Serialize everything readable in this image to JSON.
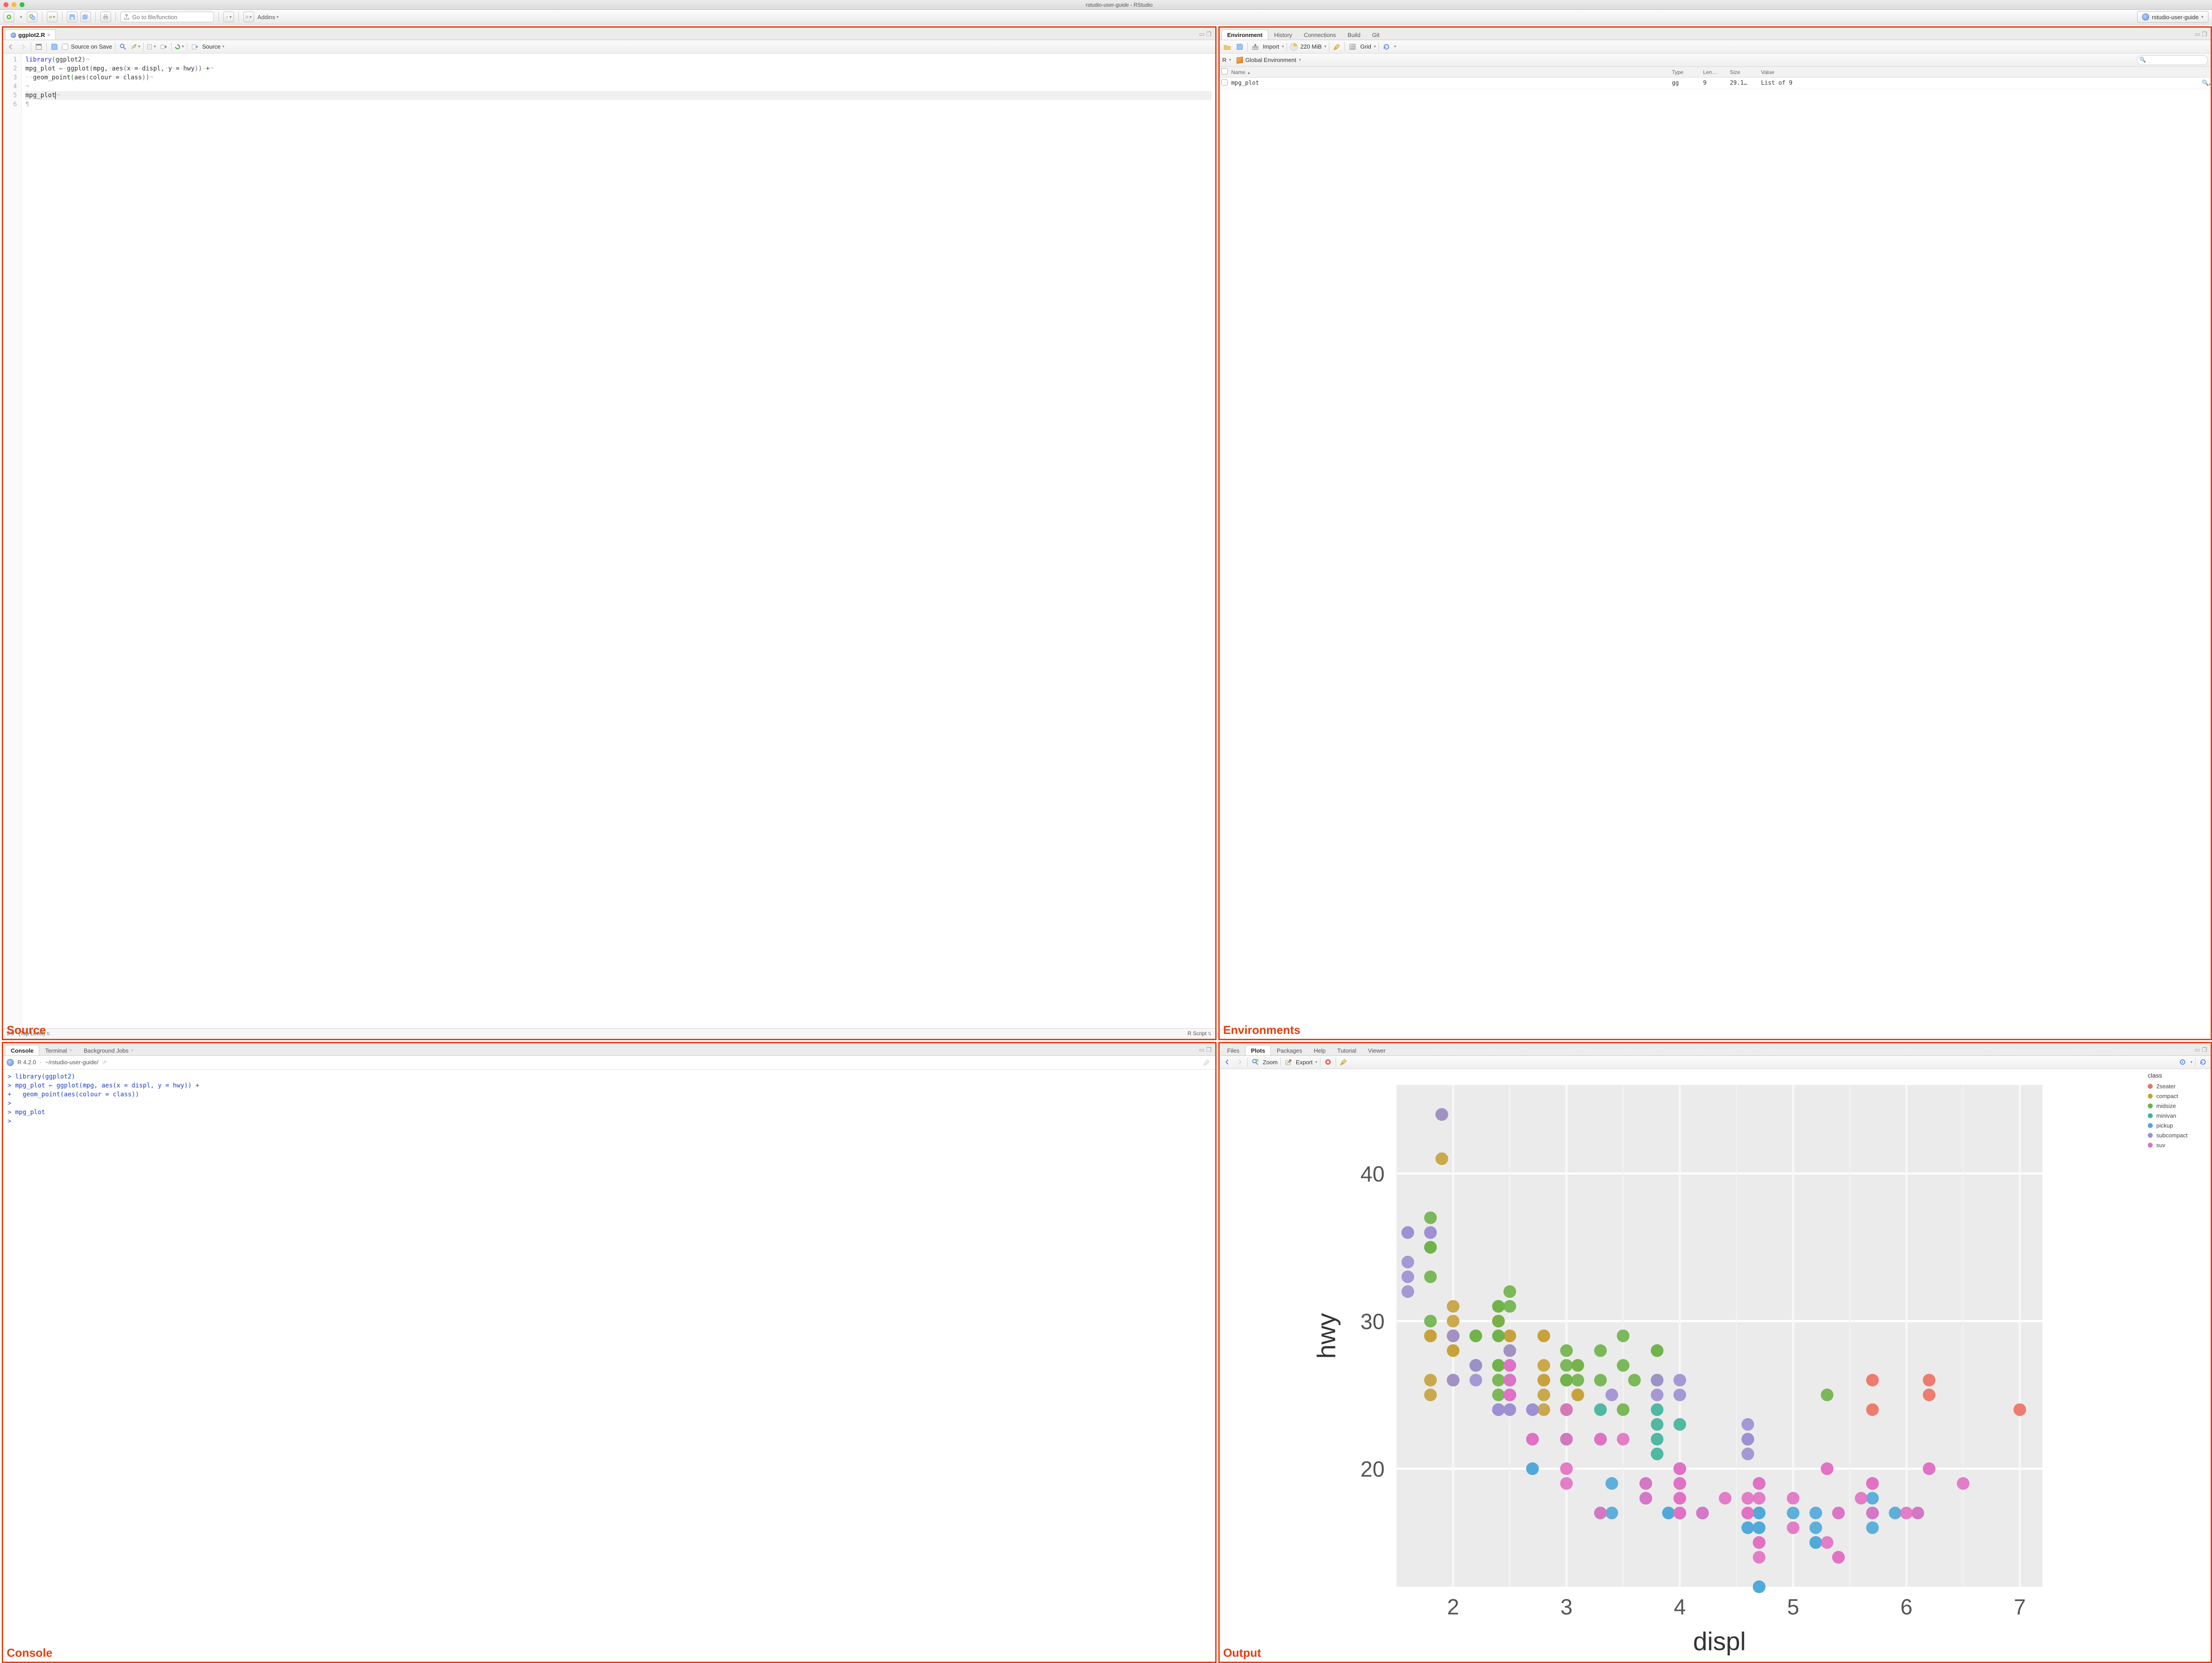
{
  "window": {
    "title": "rstudio-user-guide - RStudio"
  },
  "toolbar": {
    "goto_placeholder": "Go to file/function",
    "addins_label": "Addins",
    "project_label": "rstudio-user-guide"
  },
  "source": {
    "tab": "ggplot2.R",
    "source_on_save": "Source on Save",
    "source_btn": "Source",
    "cursor": "5:9",
    "scope": "(Top Level)",
    "lang": "R Script",
    "lines": [
      "1",
      "2",
      "3",
      "4",
      "5",
      "6"
    ]
  },
  "console": {
    "tabs": {
      "console": "Console",
      "terminal": "Terminal",
      "jobs": "Background Jobs"
    },
    "version": "R 4.2.0",
    "path": "~/rstudio-user-guide/",
    "lines": [
      "> library(ggplot2)",
      "> mpg_plot ← ggplot(mpg, aes(x = displ, y = hwy)) +",
      "+   geom_point(aes(colour = class))",
      ">",
      "> mpg_plot",
      "> "
    ]
  },
  "env": {
    "tabs": {
      "environment": "Environment",
      "history": "History",
      "connections": "Connections",
      "build": "Build",
      "git": "Git"
    },
    "import": "Import",
    "mem": "220 MiB",
    "grid": "Grid",
    "scope_lang": "R",
    "scope_env": "Global Environment",
    "search_placeholder": "",
    "cols": {
      "name": "Name",
      "type": "Type",
      "length": "Len…",
      "size": "Size",
      "value": "Value"
    },
    "row": {
      "name": "mpg_plot",
      "type": "gg",
      "length": "9",
      "size": "29.1…",
      "value": "List of 9"
    }
  },
  "output": {
    "tabs": {
      "files": "Files",
      "plots": "Plots",
      "packages": "Packages",
      "help": "Help",
      "tutorial": "Tutorial",
      "viewer": "Viewer"
    },
    "zoom": "Zoom",
    "export": "Export"
  },
  "labels": {
    "source": "Source",
    "console": "Console",
    "environments": "Environments",
    "output": "Output"
  },
  "chart_data": {
    "type": "scatter",
    "title": "",
    "xlabel": "displ",
    "ylabel": "hwy",
    "xlim": [
      1.5,
      7.2
    ],
    "ylim": [
      12,
      46
    ],
    "x_ticks": [
      2,
      3,
      4,
      5,
      6,
      7
    ],
    "y_ticks": [
      20,
      30,
      40
    ],
    "legend_title": "class",
    "series": [
      {
        "name": "2seater",
        "color": "#ed7062",
        "points": [
          [
            5.7,
            26
          ],
          [
            5.7,
            24
          ],
          [
            6.2,
            26
          ],
          [
            6.2,
            25
          ],
          [
            7.0,
            24
          ]
        ]
      },
      {
        "name": "compact",
        "color": "#c7a13b",
        "points": [
          [
            1.8,
            29
          ],
          [
            1.8,
            29
          ],
          [
            2.0,
            31
          ],
          [
            2.0,
            30
          ],
          [
            2.8,
            26
          ],
          [
            2.8,
            26
          ],
          [
            3.1,
            27
          ],
          [
            1.8,
            26
          ],
          [
            1.8,
            25
          ],
          [
            2.0,
            28
          ],
          [
            2.0,
            29
          ],
          [
            2.8,
            27
          ],
          [
            2.8,
            25
          ],
          [
            3.1,
            25
          ],
          [
            3.1,
            25
          ],
          [
            2.4,
            30
          ],
          [
            2.4,
            30
          ],
          [
            2.5,
            26
          ],
          [
            2.5,
            27
          ],
          [
            2.2,
            27
          ],
          [
            2.2,
            29
          ],
          [
            2.4,
            31
          ],
          [
            2.4,
            30
          ],
          [
            3.0,
            26
          ],
          [
            2.0,
            29
          ],
          [
            2.0,
            29
          ],
          [
            2.0,
            28
          ],
          [
            2.0,
            29
          ],
          [
            2.8,
            24
          ],
          [
            1.9,
            44
          ],
          [
            2.0,
            26
          ],
          [
            2.0,
            29
          ],
          [
            2.0,
            29
          ],
          [
            2.0,
            29
          ],
          [
            2.0,
            29
          ],
          [
            2.5,
            29
          ],
          [
            2.5,
            29
          ],
          [
            2.8,
            29
          ],
          [
            2.8,
            29
          ],
          [
            1.9,
            41
          ],
          [
            1.9,
            44
          ],
          [
            2.0,
            29
          ],
          [
            2.0,
            26
          ],
          [
            2.5,
            28
          ],
          [
            2.5,
            29
          ],
          [
            1.8,
            29
          ],
          [
            1.8,
            29
          ]
        ]
      },
      {
        "name": "midsize",
        "color": "#6fb24a",
        "points": [
          [
            2.4,
            27
          ],
          [
            2.4,
            27
          ],
          [
            3.1,
            26
          ],
          [
            3.5,
            29
          ],
          [
            3.6,
            26
          ],
          [
            2.4,
            26
          ],
          [
            2.4,
            25
          ],
          [
            2.4,
            27
          ],
          [
            2.4,
            30
          ],
          [
            2.5,
            26
          ],
          [
            2.5,
            25
          ],
          [
            3.3,
            26
          ],
          [
            2.5,
            31
          ],
          [
            2.5,
            32
          ],
          [
            3.0,
            27
          ],
          [
            3.0,
            28
          ],
          [
            3.5,
            27
          ],
          [
            3.1,
            27
          ],
          [
            3.8,
            26
          ],
          [
            3.8,
            28
          ],
          [
            3.8,
            28
          ],
          [
            5.3,
            25
          ],
          [
            2.2,
            29
          ],
          [
            2.2,
            29
          ],
          [
            2.4,
            29
          ],
          [
            2.4,
            29
          ],
          [
            3.0,
            24
          ],
          [
            3.0,
            24
          ],
          [
            3.5,
            24
          ],
          [
            2.2,
            27
          ],
          [
            2.2,
            27
          ],
          [
            2.4,
            31
          ],
          [
            2.4,
            31
          ],
          [
            3.0,
            26
          ],
          [
            3.0,
            26
          ],
          [
            3.3,
            28
          ],
          [
            1.8,
            30
          ],
          [
            1.8,
            33
          ],
          [
            1.8,
            35
          ],
          [
            1.8,
            37
          ],
          [
            1.8,
            35
          ]
        ]
      },
      {
        "name": "minivan",
        "color": "#3fb39b",
        "points": [
          [
            2.4,
            24
          ],
          [
            3.0,
            22
          ],
          [
            3.3,
            22
          ],
          [
            3.3,
            22
          ],
          [
            3.3,
            17
          ],
          [
            3.8,
            24
          ],
          [
            3.8,
            22
          ],
          [
            3.8,
            21
          ],
          [
            3.8,
            23
          ],
          [
            3.3,
            24
          ],
          [
            4.0,
            23
          ]
        ]
      },
      {
        "name": "pickup",
        "color": "#4fa8d8",
        "points": [
          [
            3.7,
            19
          ],
          [
            3.7,
            18
          ],
          [
            3.9,
            17
          ],
          [
            3.9,
            17
          ],
          [
            4.7,
            19
          ],
          [
            4.7,
            19
          ],
          [
            4.7,
            12
          ],
          [
            5.2,
            17
          ],
          [
            5.2,
            15
          ],
          [
            5.7,
            16
          ],
          [
            5.9,
            17
          ],
          [
            4.7,
            17
          ],
          [
            4.7,
            16
          ],
          [
            4.7,
            16
          ],
          [
            4.7,
            17
          ],
          [
            4.7,
            12
          ],
          [
            4.7,
            17
          ],
          [
            5.2,
            16
          ],
          [
            5.2,
            15
          ],
          [
            5.7,
            18
          ],
          [
            5.7,
            17
          ],
          [
            6.1,
            17
          ],
          [
            2.7,
            20
          ],
          [
            2.7,
            20
          ],
          [
            2.7,
            22
          ],
          [
            3.4,
            17
          ],
          [
            3.4,
            19
          ],
          [
            4.0,
            20
          ],
          [
            4.0,
            17
          ],
          [
            4.6,
            16
          ],
          [
            5.0,
            17
          ],
          [
            4.2,
            17
          ],
          [
            4.2,
            17
          ],
          [
            4.6,
            16
          ]
        ]
      },
      {
        "name": "subcompact",
        "color": "#9d8fd2",
        "points": [
          [
            3.8,
            26
          ],
          [
            3.8,
            25
          ],
          [
            4.0,
            26
          ],
          [
            4.0,
            25
          ],
          [
            4.6,
            21
          ],
          [
            4.6,
            22
          ],
          [
            4.6,
            23
          ],
          [
            4.6,
            22
          ],
          [
            5.4,
            17
          ],
          [
            1.6,
            33
          ],
          [
            1.6,
            32
          ],
          [
            1.6,
            34
          ],
          [
            1.6,
            36
          ],
          [
            1.6,
            36
          ],
          [
            1.8,
            36
          ],
          [
            1.8,
            36
          ],
          [
            2.0,
            29
          ],
          [
            2.4,
            24
          ],
          [
            2.4,
            24
          ],
          [
            2.5,
            24
          ],
          [
            2.5,
            24
          ],
          [
            2.5,
            26
          ],
          [
            2.5,
            26
          ],
          [
            2.2,
            26
          ],
          [
            2.2,
            27
          ],
          [
            2.5,
            25
          ],
          [
            2.5,
            27
          ],
          [
            2.5,
            25
          ],
          [
            2.5,
            27
          ],
          [
            2.7,
            24
          ],
          [
            2.7,
            24
          ],
          [
            3.4,
            25
          ],
          [
            1.9,
            44
          ],
          [
            2.0,
            26
          ],
          [
            2.5,
            28
          ]
        ]
      },
      {
        "name": "suv",
        "color": "#e171c3",
        "points": [
          [
            5.3,
            20
          ],
          [
            5.3,
            15
          ],
          [
            5.3,
            20
          ],
          [
            5.7,
            17
          ],
          [
            6.0,
            17
          ],
          [
            5.7,
            19
          ],
          [
            5.7,
            19
          ],
          [
            6.2,
            20
          ],
          [
            6.2,
            20
          ],
          [
            6.5,
            19
          ],
          [
            2.7,
            22
          ],
          [
            2.7,
            22
          ],
          [
            2.7,
            22
          ],
          [
            3.0,
            19
          ],
          [
            3.7,
            18
          ],
          [
            4.0,
            17
          ],
          [
            4.0,
            18
          ],
          [
            4.0,
            17
          ],
          [
            4.0,
            17
          ],
          [
            4.7,
            14
          ],
          [
            4.7,
            15
          ],
          [
            4.7,
            15
          ],
          [
            4.0,
            19
          ],
          [
            4.0,
            19
          ],
          [
            4.6,
            17
          ],
          [
            5.0,
            18
          ],
          [
            3.0,
            20
          ],
          [
            3.7,
            19
          ],
          [
            4.0,
            20
          ],
          [
            4.7,
            18
          ],
          [
            4.7,
            19
          ],
          [
            4.7,
            19
          ],
          [
            5.7,
            19
          ],
          [
            6.1,
            17
          ],
          [
            4.0,
            17
          ],
          [
            4.2,
            17
          ],
          [
            4.4,
            18
          ],
          [
            4.6,
            17
          ],
          [
            5.4,
            14
          ],
          [
            5.4,
            17
          ],
          [
            5.4,
            14
          ],
          [
            4.0,
            19
          ],
          [
            4.0,
            18
          ],
          [
            4.0,
            17
          ],
          [
            4.0,
            20
          ],
          [
            4.0,
            17
          ],
          [
            4.0,
            18
          ],
          [
            4.0,
            18
          ],
          [
            4.0,
            20
          ],
          [
            4.6,
            18
          ],
          [
            5.0,
            16
          ],
          [
            3.3,
            22
          ],
          [
            3.3,
            22
          ],
          [
            4.0,
            20
          ],
          [
            5.6,
            18
          ],
          [
            3.0,
            22
          ],
          [
            3.0,
            24
          ],
          [
            3.5,
            22
          ],
          [
            3.3,
            17
          ],
          [
            2.5,
            27
          ],
          [
            2.5,
            25
          ],
          [
            2.5,
            26
          ],
          [
            2.5,
            25
          ]
        ]
      }
    ]
  }
}
